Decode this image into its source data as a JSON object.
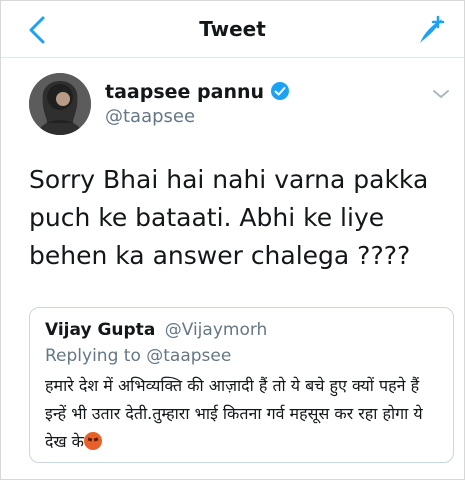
{
  "nav": {
    "title": "Tweet"
  },
  "tweet": {
    "author_name": "taapsee pannu",
    "author_handle": "@taapsee",
    "text": "Sorry Bhai hai nahi varna pakka puch ke bataati. Abhi ke liye behen ka answer chalega ????"
  },
  "quote": {
    "name": "Vijay Gupta",
    "handle": "@Vijaymorh",
    "replying_to": "Replying to @taapsee",
    "text": "हमारे देश में अभिव्यक्ति की आज़ादी हैं तो ये बचे हुए क्यों पहने हैं इन्हें भी उतार देती.तुम्हारा भाई कितना गर्व महसूस कर रहा होगा ये देख के",
    "emoji": "angry-face-icon"
  },
  "colors": {
    "accent": "#1da1f2",
    "muted": "#657786",
    "text": "#14171a"
  }
}
